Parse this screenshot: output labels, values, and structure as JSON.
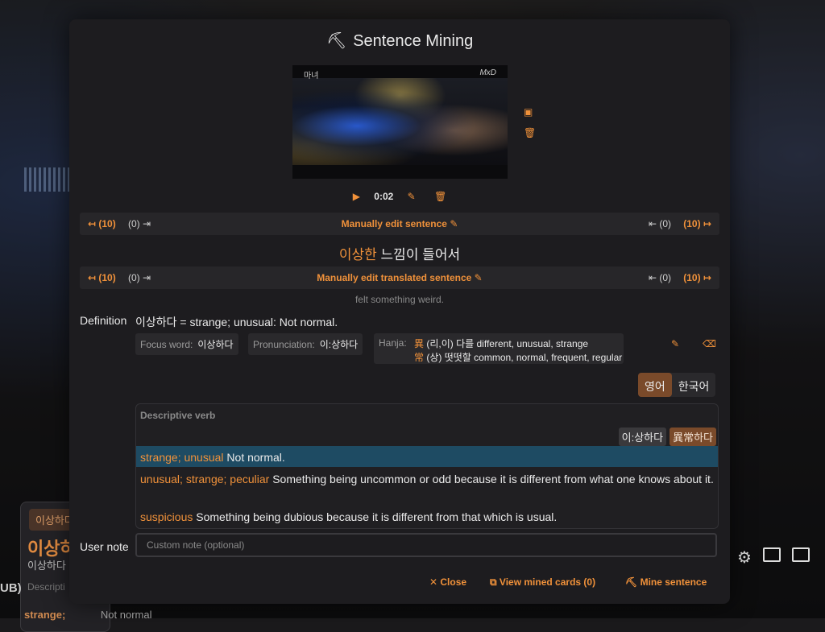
{
  "background": {
    "card_chip": "이상하다",
    "card_word": "이상하다",
    "card_reading": "이상하다",
    "card_desc": "Descripti",
    "left_text": "UB)",
    "bottom_word": "strange;",
    "bottom_def": "Not normal"
  },
  "modal": {
    "title": "Sentence Mining",
    "title_icon": "pickaxe-icon",
    "video_watermark_left": "마녀",
    "video_watermark_right": "MxD",
    "time": "0:02",
    "sentence_bar": {
      "left_extend": "↤ (10)",
      "left_trim": "(0) ⇥",
      "label": "Manually edit sentence",
      "right_trim": "⇤ (0)",
      "right_extend": "(10) ↦"
    },
    "sentence": {
      "highlight": "이상한",
      "rest": " 느낌이 들어서"
    },
    "translation_bar": {
      "left_extend": "↤ (10)",
      "left_trim": "(0) ⇥",
      "label": "Manually edit translated sentence",
      "right_trim": "⇤ (0)",
      "right_extend": "(10) ↦"
    },
    "translation": "felt something weird.",
    "definition_label": "Definition",
    "definition_text": "이상하다 = strange; unusual: Not normal.",
    "focus_word_key": "Focus word:",
    "focus_word_val": "이상하다",
    "pronunciation_key": "Pronunciation:",
    "pronunciation_val": "이:상하다",
    "hanja_key": "Hanja:",
    "hanja_lines": [
      {
        "char": "異",
        "text": " (리,이) 다를 different, unusual, strange"
      },
      {
        "char": "常",
        "text": " (상) 떳떳할 common, normal, frequent, regular"
      }
    ],
    "lang_tabs": [
      "영어",
      "한국어"
    ],
    "active_lang": "영어",
    "dictionary": {
      "pos": "Descriptive verb",
      "tags": [
        "이:상하다",
        "異常하다"
      ],
      "senses": [
        {
          "words": "strange; unusual",
          "def": " Not normal.",
          "selected": true
        },
        {
          "words": "unusual; strange; peculiar",
          "def": " Something being uncommon or odd because it is different from what one knows about it.",
          "selected": false
        },
        {
          "words": "suspicious",
          "def": " Something being dubious because it is different from that which is usual.",
          "selected": false
        }
      ]
    },
    "user_note_label": "User note",
    "user_note_placeholder": "Custom note (optional)",
    "footer": {
      "close": "✕ Close",
      "view": "View mined cards (0)",
      "mine": "Mine sentence"
    }
  },
  "colors": {
    "accent": "#f0913a",
    "selected_sense": "#1e4b63",
    "tag_hanja": "#7a4a2a"
  }
}
